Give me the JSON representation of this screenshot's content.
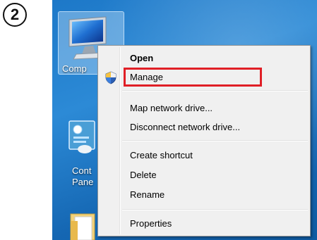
{
  "step": {
    "number": "2"
  },
  "desktop": {
    "icons": [
      {
        "label": "Comp"
      },
      {
        "label": "Cont"
      },
      {
        "label": "Pane"
      }
    ]
  },
  "context_menu": {
    "items": [
      {
        "label": "Open",
        "bold": true
      },
      {
        "label": "Manage",
        "icon": "uac-shield-icon",
        "highlighted": true
      },
      {
        "label": "Map network drive..."
      },
      {
        "label": "Disconnect network drive..."
      },
      {
        "label": "Create shortcut"
      },
      {
        "label": "Delete"
      },
      {
        "label": "Rename"
      },
      {
        "label": "Properties"
      }
    ]
  },
  "colors": {
    "highlight": "#e01f26",
    "desktop": "#1d78c8"
  }
}
